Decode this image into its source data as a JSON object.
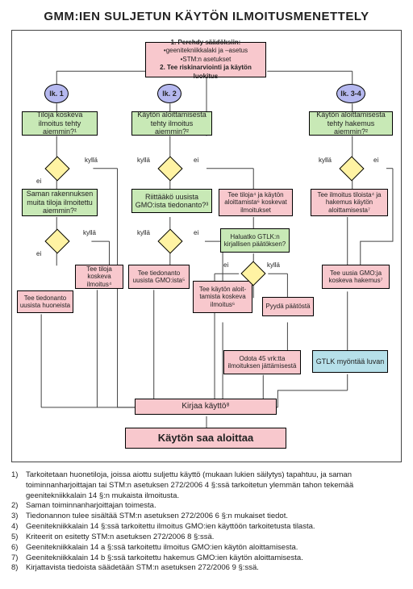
{
  "title": "GMM:IEN SULJETUN KÄYTÖN ILMOITUSMENETTELY",
  "start": {
    "l1": "1. Perehdy säädöksiin:",
    "l2": "•geenitekniikkalaki ja –asetus",
    "l3": "•STM:n asetukset",
    "l4": "2. Tee riskinarviointi ja käytön luokitus"
  },
  "lk": {
    "a": "lk. 1",
    "b": "lk. 2",
    "c": "lk. 3-4"
  },
  "col1": {
    "q1": "Tiloja koskeva ilmoitus tehty aiemmin?¹",
    "q2": "Saman rakennuksen muita tiloja ilmoitettu aiemmin?²",
    "t1": "Tee tiloja koskeva ilmoitus⁴",
    "t2": "Tee tiedonanto uusista huoneista"
  },
  "col2": {
    "q1": "Käytön aloittamisesta tehty ilmoitus aiemmin?²",
    "q2": "Riittääkö uusista GMO:ista tiedonanto?³",
    "t1": "Tee tiedonanto uusista GMO:ista⁵",
    "t2": "Tee käytön aloit-\ntamista koskeva ilmoitus⁶",
    "q3": "Haluatko GTLK:n kirjallisen päätöksen?",
    "t3": "Tee tiloja⁴ ja käytön aloittamista⁶ koskevat ilmoitukset",
    "t4": "Pyydä päätöstä",
    "t5": "Odota 45 vrk:tta ilmoituksen jättämisestä"
  },
  "col3": {
    "q1": "Käytön aloittamisesta tehty hakemus aiemmin?²",
    "t1": "Tee ilmoitus tiloista⁴ ja hakemus käytön aloittamisesta⁷",
    "t2": "Tee uusia GMO:ja koskeva hakemus⁷",
    "t3": "GTLK myöntää luvan"
  },
  "edges": {
    "ei": "ei",
    "kylla": "kyllä"
  },
  "bottom": {
    "kirjaa": "Kirjaa käyttö⁸",
    "aloita": "Käytön saa aloittaa"
  },
  "fn": {
    "1": "Tarkoitetaan huonetiloja, joissa aiottu suljettu käyttö (mukaan lukien säilytys) tapahtuu, ja saman toiminnanharjoittajan tai STM:n asetuksen 272/2006 4 §:ssä tarkoitetun ylemmän tahon tekemää geenitekniikkalain 14 §:n mukaista ilmoitusta.",
    "2": "Saman toiminnanharjoittajan toimesta.",
    "3": "Tiedonannon tulee sisältää STM:n asetuksen 272/2006 6 §:n mukaiset tiedot.",
    "4": "Geenitekniikkalain 14 §:ssä tarkoitettu ilmoitus GMO:ien käyttöön tarkoitetusta tilasta.",
    "5": "Kriteerit on esitetty STM:n asetuksen 272/2006 8 §:ssä.",
    "6": "Geenitekniikkalain 14 a §:ssä tarkoitettu ilmoitus GMO:ien käytön aloittamisesta.",
    "7": "Geenitekniikkalain 14 b §:ssä tarkoitettu hakemus GMO:ien käytön aloittamisesta.",
    "8": "Kirjattavista tiedoista säädetään STM:n asetuksen 272/2006 9 §:ssä."
  }
}
